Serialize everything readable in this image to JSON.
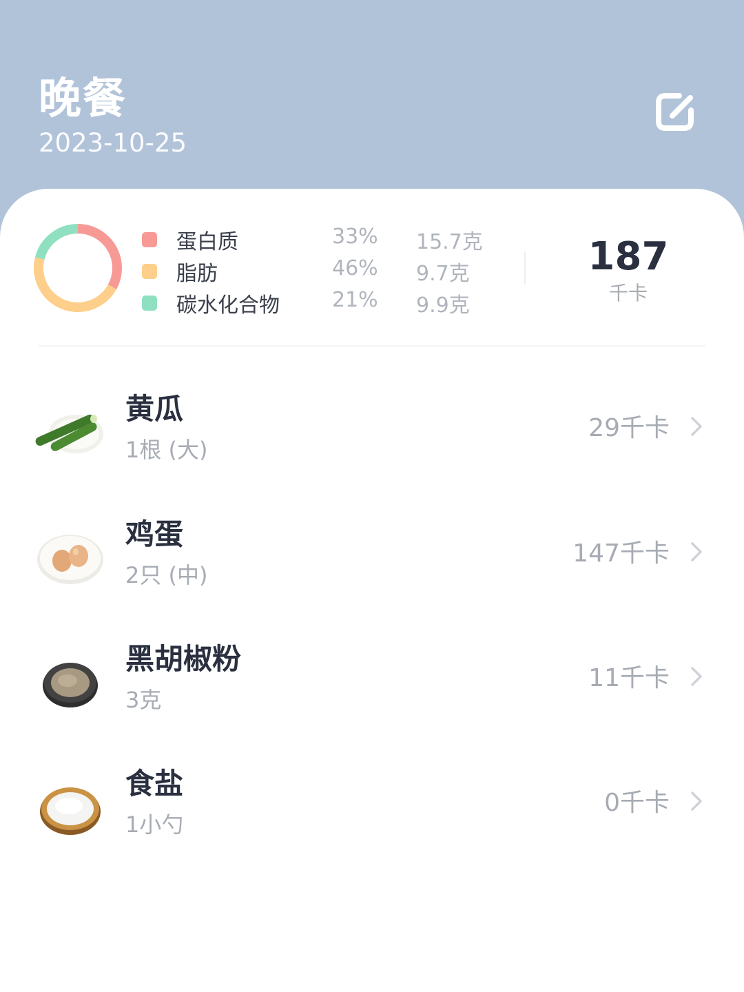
{
  "header": {
    "title": "晚餐",
    "date": "2023-10-25"
  },
  "nutrition": {
    "items": [
      {
        "name": "蛋白质",
        "percent": "33%",
        "amount": "15.7克",
        "color": "#f79a96"
      },
      {
        "name": "脂肪",
        "percent": "46%",
        "amount": "9.7克",
        "color": "#fdcf8a"
      },
      {
        "name": "碳水化合物",
        "percent": "21%",
        "amount": "9.9克",
        "color": "#8ee0c0"
      }
    ],
    "total_kcal": "187",
    "total_unit": "千卡"
  },
  "foods": [
    {
      "name": "黄瓜",
      "quantity": "1根 (大)",
      "kcal": "29千卡",
      "icon": "cucumber-icon"
    },
    {
      "name": "鸡蛋",
      "quantity": "2只 (中)",
      "kcal": "147千卡",
      "icon": "egg-icon"
    },
    {
      "name": "黑胡椒粉",
      "quantity": "3克",
      "kcal": "11千卡",
      "icon": "black-pepper-icon"
    },
    {
      "name": "食盐",
      "quantity": "1小勺",
      "kcal": "0千卡",
      "icon": "salt-icon"
    }
  ],
  "colors": {
    "header_bg": "#b1c3d9",
    "card_bg": "#ffffff",
    "protein": "#f79a96",
    "fat": "#fdcf8a",
    "carb": "#8ee0c0"
  }
}
